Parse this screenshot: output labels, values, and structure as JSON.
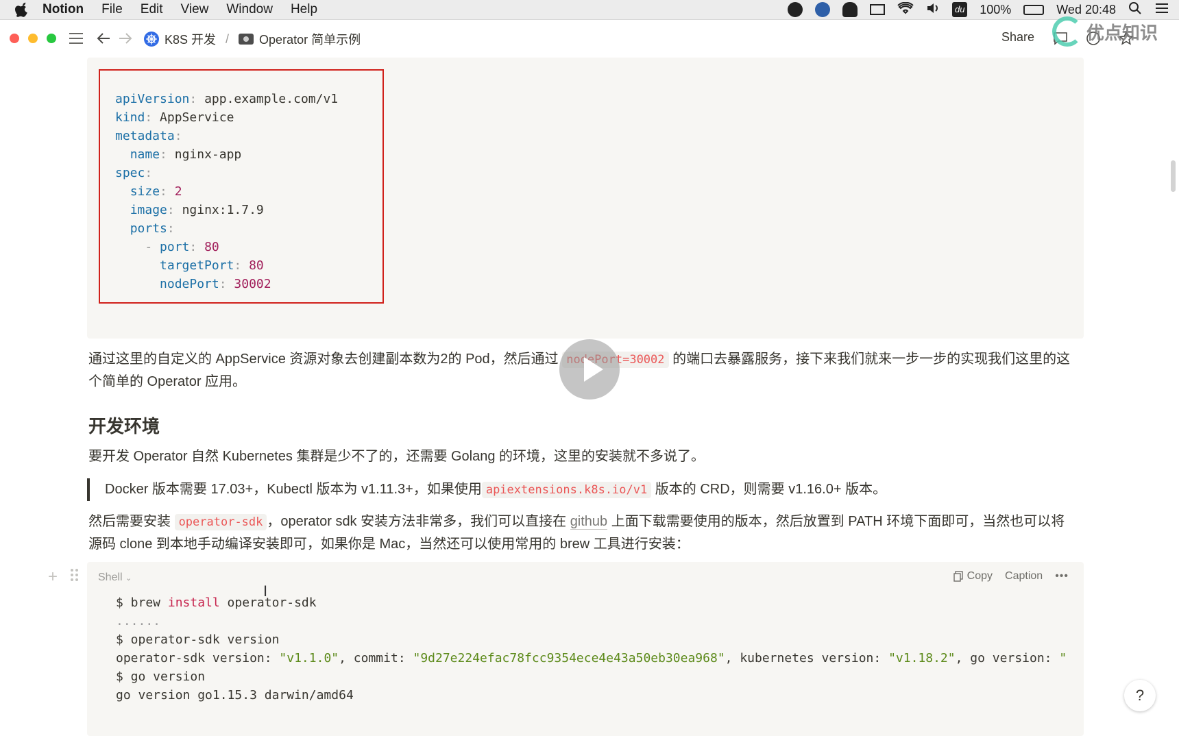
{
  "menubar": {
    "app": "Notion",
    "items": [
      "File",
      "Edit",
      "View",
      "Window",
      "Help"
    ],
    "battery": "100%",
    "clock": "Wed 20:48"
  },
  "topbar": {
    "breadcrumb": [
      {
        "label": "K8S 开发"
      },
      {
        "label": "Operator 简单示例"
      }
    ],
    "separator": "/",
    "share_label": "Share"
  },
  "watermark": "优点知识",
  "yaml_lines": [
    [
      [
        "k",
        "apiVersion"
      ],
      [
        "p",
        ": "
      ],
      [
        "t",
        "app.example.com/v1"
      ]
    ],
    [
      [
        "k",
        "kind"
      ],
      [
        "p",
        ": "
      ],
      [
        "t",
        "AppService"
      ]
    ],
    [
      [
        "k",
        "metadata"
      ],
      [
        "p",
        ":"
      ]
    ],
    [
      [
        "t",
        "  "
      ],
      [
        "k",
        "name"
      ],
      [
        "p",
        ": "
      ],
      [
        "t",
        "nginx-app"
      ]
    ],
    [
      [
        "k",
        "spec"
      ],
      [
        "p",
        ":"
      ]
    ],
    [
      [
        "t",
        "  "
      ],
      [
        "k",
        "size"
      ],
      [
        "p",
        ": "
      ],
      [
        "n",
        "2"
      ]
    ],
    [
      [
        "t",
        "  "
      ],
      [
        "k",
        "image"
      ],
      [
        "p",
        ": "
      ],
      [
        "t",
        "nginx:1.7.9"
      ]
    ],
    [
      [
        "t",
        "  "
      ],
      [
        "k",
        "ports"
      ],
      [
        "p",
        ":"
      ]
    ],
    [
      [
        "t",
        "    "
      ],
      [
        "p",
        "- "
      ],
      [
        "k",
        "port"
      ],
      [
        "p",
        ": "
      ],
      [
        "n",
        "80"
      ]
    ],
    [
      [
        "t",
        "      "
      ],
      [
        "k",
        "targetPort"
      ],
      [
        "p",
        ": "
      ],
      [
        "n",
        "80"
      ]
    ],
    [
      [
        "t",
        "      "
      ],
      [
        "k",
        "nodePort"
      ],
      [
        "p",
        ": "
      ],
      [
        "n",
        "30002"
      ]
    ]
  ],
  "para1": {
    "before": "通过这里的自定义的 AppService 资源对象去创建副本数为2的 Pod，然后通过 ",
    "code": "nodePort=30002",
    "after": " 的端口去暴露服务，接下来我们就来一步一步的实现我们这里的这个简单的 Operator 应用。"
  },
  "heading": "开发环境",
  "para2": "要开发 Operator 自然 Kubernetes 集群是少不了的，还需要 Golang 的环境，这里的安装就不多说了。",
  "quote": {
    "before": "Docker 版本需要 17.03+，Kubectl 版本为 v1.11.3+，如果使用",
    "code": "apiextensions.k8s.io/v1",
    "after": " 版本的 CRD，则需要 v1.16.0+ 版本。"
  },
  "para3": {
    "before": "然后需要安装 ",
    "code": "operator-sdk",
    "mid": "，operator sdk 安装方法非常多，我们可以直接在 ",
    "link": "github",
    "after": " 上面下载需要使用的版本，然后放置到 PATH 环境下面即可，当然也可以将源码 clone 到本地手动编译安装即可，如果你是 Mac，当然还可以使用常用的 brew 工具进行安装："
  },
  "shell_block": {
    "language": "Shell",
    "copy_label": "Copy",
    "caption_label": "Caption",
    "more_label": "•••",
    "lines": [
      [
        [
          "t",
          "$ brew "
        ],
        [
          "kw",
          "install"
        ],
        [
          "t",
          " operator-sdk"
        ]
      ],
      [
        [
          "p",
          "......"
        ]
      ],
      [
        [
          "t",
          "$ operator-sdk version"
        ]
      ],
      [
        [
          "t",
          "operator-sdk version: "
        ],
        [
          "s",
          "\"v1.1.0\""
        ],
        [
          "t",
          ", commit: "
        ],
        [
          "s",
          "\"9d27e224efac78fcc9354ece4e43a50eb30ea968\""
        ],
        [
          "t",
          ", kubernetes version: "
        ],
        [
          "s",
          "\"v1.18.2\""
        ],
        [
          "t",
          ", go version: "
        ],
        [
          "s",
          "\""
        ]
      ],
      [
        [
          "t",
          "$ go version"
        ]
      ],
      [
        [
          "t",
          "go version go1.15.3 darwin/amd64"
        ]
      ]
    ]
  },
  "help_label": "?"
}
